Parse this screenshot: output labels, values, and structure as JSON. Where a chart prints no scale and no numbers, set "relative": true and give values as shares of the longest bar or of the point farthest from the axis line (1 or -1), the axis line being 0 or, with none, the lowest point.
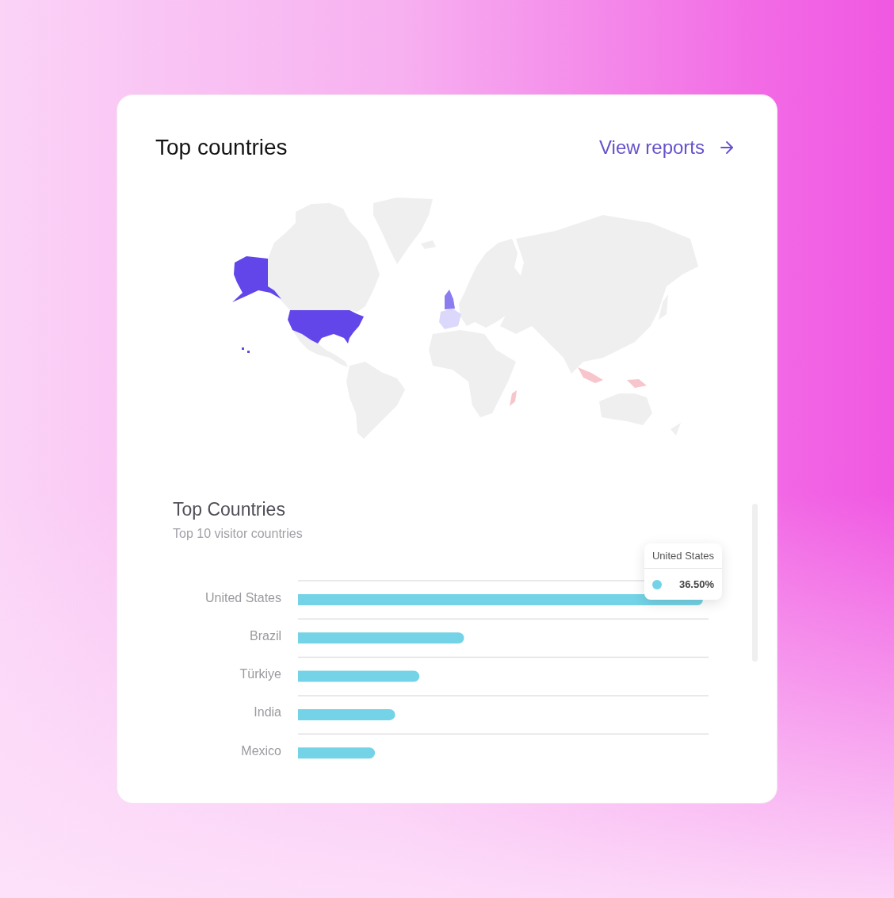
{
  "card": {
    "title": "Top countries",
    "link": {
      "label": "View reports"
    }
  },
  "top_countries": {
    "title": "Top Countries",
    "subtitle": "Top 10 visitor countries",
    "chart_data": {
      "type": "bar",
      "orientation": "horizontal",
      "relative": true,
      "categories": [
        "United States",
        "Brazil",
        "Türkiye",
        "India",
        "Mexico"
      ],
      "series": [
        {
          "color": "#74d3e6",
          "values": [
            1,
            0.41,
            0.3,
            0.24,
            0.19
          ]
        }
      ]
    },
    "tooltip": {
      "title": "United States",
      "value": "36.50%",
      "color": "#74d3e6"
    }
  }
}
